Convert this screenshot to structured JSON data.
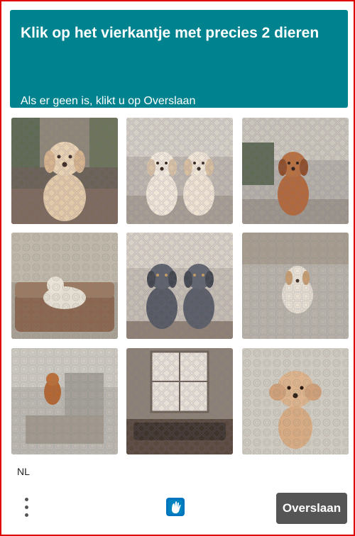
{
  "header": {
    "title": "Klik op het vierkantje met precies 2 dieren",
    "subtitle": "Als er geen is, klikt u op Overslaan"
  },
  "tiles": [
    {
      "subject": "one puppy sitting on a rug"
    },
    {
      "subject": "two puppies sitting side by side"
    },
    {
      "subject": "one brown puppy in a living room"
    },
    {
      "subject": "one blurred animal lying on a couch"
    },
    {
      "subject": "two grey puppies sitting"
    },
    {
      "subject": "one puppy on patterned squares"
    },
    {
      "subject": "one small brown animal in a room"
    },
    {
      "subject": "empty living room with window"
    },
    {
      "subject": "one poodle puppy close-up"
    }
  ],
  "footer": {
    "language": "NL",
    "skip_label": "Overslaan",
    "menu_icon": "kebab-menu-icon",
    "logo_icon": "hcaptcha-logo-icon"
  },
  "colors": {
    "header_bg": "#00838f",
    "skip_bg": "#555555",
    "frame_border": "#e00000"
  }
}
